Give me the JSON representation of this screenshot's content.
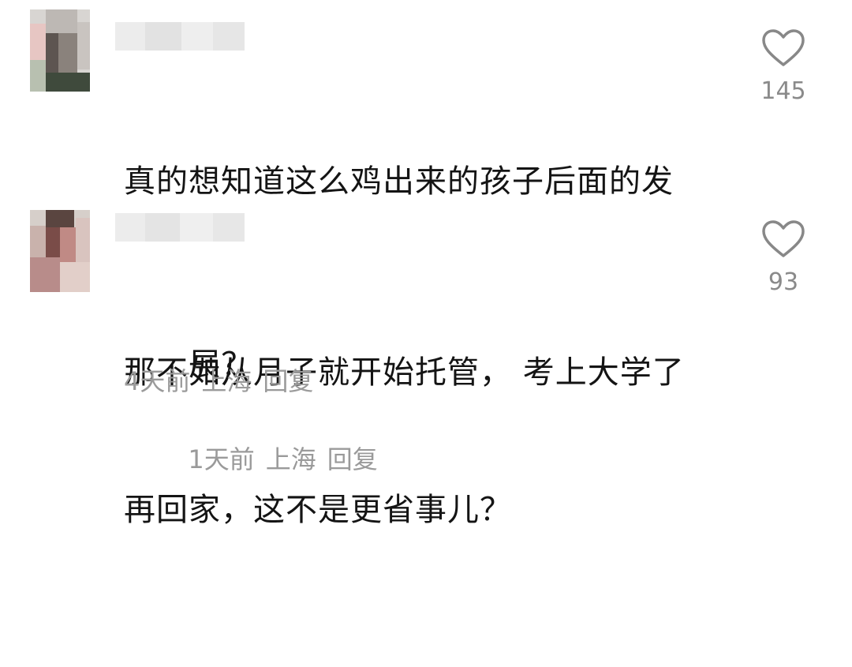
{
  "comments": [
    {
      "text": "真的想知道这么鸡出来的孩子后面的发展？",
      "text_line1": "真的想知道这么鸡出来的孩子后面的发",
      "text_line2": "展？",
      "time": "1天前",
      "location": "上海",
      "reply_label": "回复",
      "like_count": "145",
      "like_icon": "heart-outline-icon"
    },
    {
      "text": "那不如从月子就开始托管， 考上大学了再回家，这不是更省事儿？",
      "text_line1": "那不如从月子就开始托管， 考上大学了",
      "text_line2": "再回家，这不是更省事儿？",
      "time": "4天前",
      "location": "上海",
      "reply_label": "回复",
      "like_count": "93",
      "like_icon": "heart-outline-icon"
    }
  ]
}
